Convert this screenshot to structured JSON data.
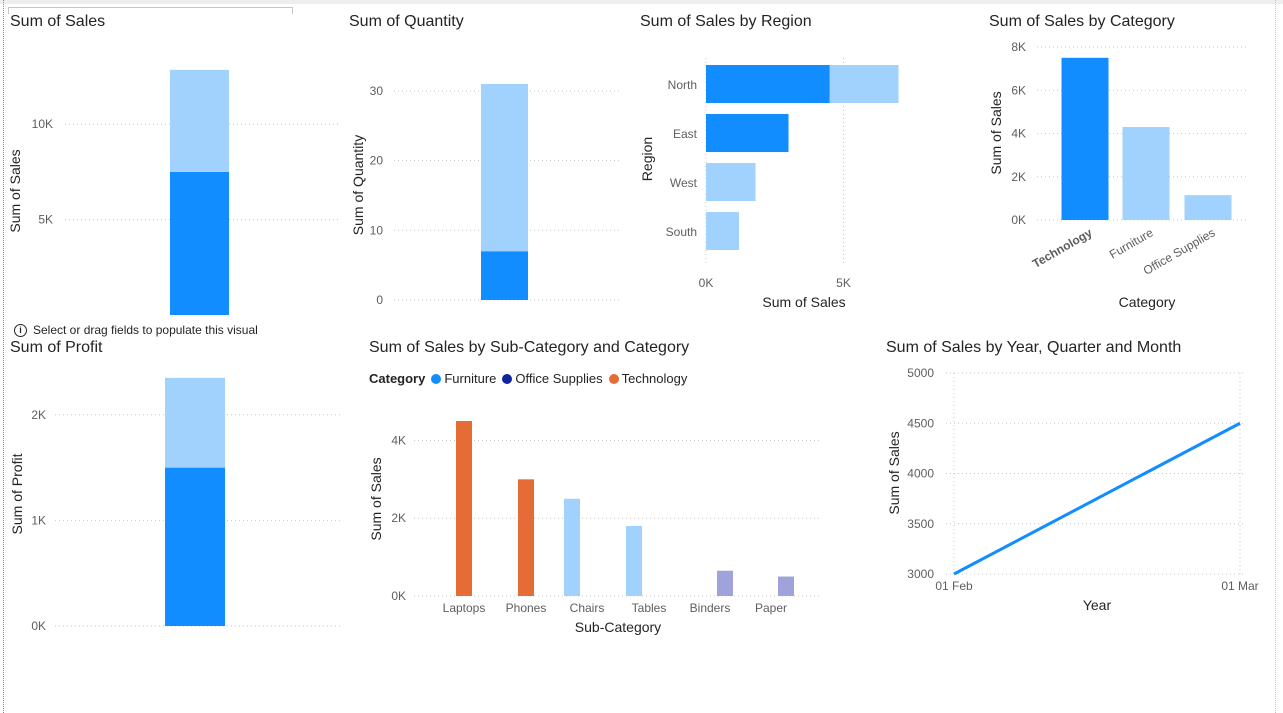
{
  "hint": {
    "text": "Select or drag fields to populate this visual"
  },
  "visuals": {
    "sales": {
      "title": "Sum of Sales"
    },
    "quantity": {
      "title": "Sum of Quantity"
    },
    "region": {
      "title": "Sum of Sales by Region"
    },
    "category": {
      "title": "Sum of Sales by Category"
    },
    "profit": {
      "title": "Sum of Profit"
    },
    "subcat": {
      "title": "Sum of Sales by Sub-Category and Category"
    },
    "time": {
      "title": "Sum of Sales by Year, Quarter and Month"
    }
  },
  "colors": {
    "dark_blue": "#118DFF",
    "light_blue": "#A1D2FD",
    "orange": "#E66C37",
    "lavender": "#A0A3D9",
    "navy": "#12239E"
  },
  "chart_data": [
    {
      "id": "sales",
      "type": "bar",
      "stacked": true,
      "xlabel": "",
      "ylabel": "Sum of Sales",
      "ylim": [
        0,
        13000
      ],
      "yticks": [
        "5K",
        "10K"
      ],
      "ytick_values": [
        5000,
        10000
      ],
      "series": [
        {
          "values": [
            7500
          ]
        },
        {
          "values": [
            5350
          ]
        }
      ]
    },
    {
      "id": "quantity",
      "type": "bar",
      "stacked": true,
      "xlabel": "",
      "ylabel": "Sum of Quantity",
      "ylim": [
        0,
        33
      ],
      "yticks": [
        "0",
        "10",
        "20",
        "30"
      ],
      "ytick_values": [
        0,
        10,
        20,
        30
      ],
      "series": [
        {
          "values": [
            7
          ]
        },
        {
          "values": [
            24
          ]
        }
      ]
    },
    {
      "id": "region",
      "type": "bar",
      "orientation": "horizontal",
      "stacked": true,
      "categories": [
        "North",
        "East",
        "West",
        "South"
      ],
      "xlabel": "Sum of Sales",
      "ylabel": "Region",
      "xlim": [
        0,
        8000
      ],
      "xticks": [
        "0K",
        "5K"
      ],
      "xtick_values": [
        0,
        5000
      ],
      "series": [
        {
          "values": [
            4500,
            3000,
            0,
            0
          ]
        },
        {
          "values": [
            2500,
            0,
            1800,
            1200
          ]
        }
      ]
    },
    {
      "id": "category",
      "type": "bar",
      "categories": [
        "Technology",
        "Furniture",
        "Office Supplies"
      ],
      "xlabel": "Category",
      "ylabel": "Sum of Sales",
      "ylim": [
        0,
        8000
      ],
      "yticks": [
        "0K",
        "2K",
        "4K",
        "6K",
        "8K"
      ],
      "ytick_values": [
        0,
        2000,
        4000,
        6000,
        8000
      ],
      "values": [
        7500,
        4300,
        1150
      ],
      "highlight": "Technology"
    },
    {
      "id": "profit",
      "type": "bar",
      "stacked": true,
      "xlabel": "",
      "ylabel": "Sum of Profit",
      "ylim": [
        0,
        2500
      ],
      "yticks": [
        "0K",
        "1K",
        "2K"
      ],
      "ytick_values": [
        0,
        1000,
        2000
      ],
      "series": [
        {
          "values": [
            1500
          ]
        },
        {
          "values": [
            850
          ]
        }
      ]
    },
    {
      "id": "subcat",
      "type": "bar",
      "categories": [
        "Laptops",
        "Phones",
        "Chairs",
        "Tables",
        "Binders",
        "Paper"
      ],
      "xlabel": "Sub-Category",
      "ylabel": "Sum of Sales",
      "ylim": [
        0,
        4500
      ],
      "yticks": [
        "0K",
        "2K",
        "4K"
      ],
      "ytick_values": [
        0,
        2000,
        4000
      ],
      "legend_title": "Category",
      "series": [
        {
          "name": "Furniture",
          "values": [
            0,
            0,
            2500,
            1800,
            0,
            0
          ]
        },
        {
          "name": "Office Supplies",
          "values": [
            0,
            0,
            0,
            0,
            650,
            500
          ]
        },
        {
          "name": "Technology",
          "values": [
            4500,
            3000,
            0,
            0,
            0,
            0
          ]
        }
      ]
    },
    {
      "id": "time",
      "type": "line",
      "xlabel": "Year",
      "ylabel": "Sum of Sales",
      "x": [
        "01 Feb",
        "01 Mar"
      ],
      "ylim": [
        3000,
        5000
      ],
      "yticks": [
        "3000",
        "3500",
        "4000",
        "4500",
        "5000"
      ],
      "ytick_values": [
        3000,
        3500,
        4000,
        4500,
        5000
      ],
      "values": [
        3000,
        4500
      ]
    }
  ]
}
